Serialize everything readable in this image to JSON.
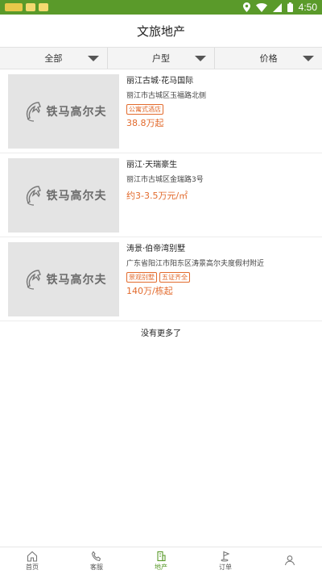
{
  "status_bar": {
    "time": "4:50",
    "icons": [
      "location-icon",
      "wifi-icon",
      "signal-icon",
      "battery-icon"
    ],
    "color": "#5a9a2a"
  },
  "header": {
    "title": "文旅地产"
  },
  "filters": [
    {
      "label": "全部"
    },
    {
      "label": "户型"
    },
    {
      "label": "价格"
    }
  ],
  "listings": [
    {
      "title": "丽江古城·花马国际",
      "address": "丽江市古城区玉福路北侧",
      "tags": [
        "公寓式酒店"
      ],
      "price": "38.8万起"
    },
    {
      "title": "丽江·天瑞豪生",
      "address": "丽江市古城区金瑞路3号",
      "tags": [],
      "price": "约3-3.5万元/㎡"
    },
    {
      "title": "涛景·伯帝湾别墅",
      "address": "广东省阳江市阳东区涛景高尔夫度假村附近",
      "tags": [
        "景观别墅",
        "五证齐全"
      ],
      "price": "140万/栋起"
    }
  ],
  "thumbnail_text": "铁马高尔夫",
  "end_message": "没有更多了",
  "tabs": [
    {
      "label": "首页",
      "icon": "home-icon"
    },
    {
      "label": "客服",
      "icon": "phone-icon"
    },
    {
      "label": "地产",
      "icon": "building-icon",
      "active": true
    },
    {
      "label": "订单",
      "icon": "golf-flag-icon"
    },
    {
      "label": "",
      "icon": "profile-icon"
    }
  ],
  "colors": {
    "accent": "#5a9a2a",
    "price": "#e26a2c"
  }
}
